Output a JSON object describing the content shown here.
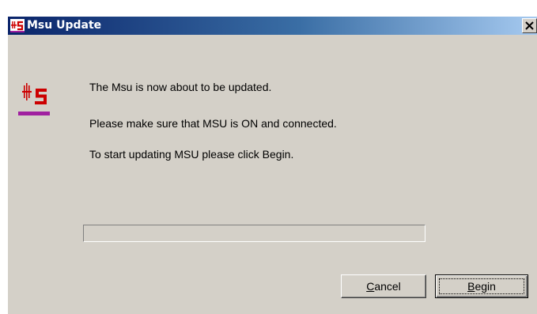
{
  "window": {
    "title": "Msu Update",
    "close_glyph": "×"
  },
  "icons": {
    "app": "msu-logo-icon",
    "message": "msu-logo-icon",
    "close": "close-icon"
  },
  "message": {
    "line1": "The Msu is now about to be updated.",
    "line2": "Please make sure that MSU is ON and connected.",
    "line3": "To start updating MSU please click Begin."
  },
  "progress": {
    "value_percent": 0
  },
  "buttons": {
    "cancel": {
      "mnemonic": "C",
      "rest": "ancel"
    },
    "begin": {
      "mnemonic": "B",
      "rest": "egin"
    }
  },
  "colors": {
    "titlebar_start": "#0a246a",
    "titlebar_end": "#a6caf0",
    "dialog_bg": "#d4d0c8",
    "logo_red": "#cc0000",
    "logo_purple": "#a020a0"
  }
}
